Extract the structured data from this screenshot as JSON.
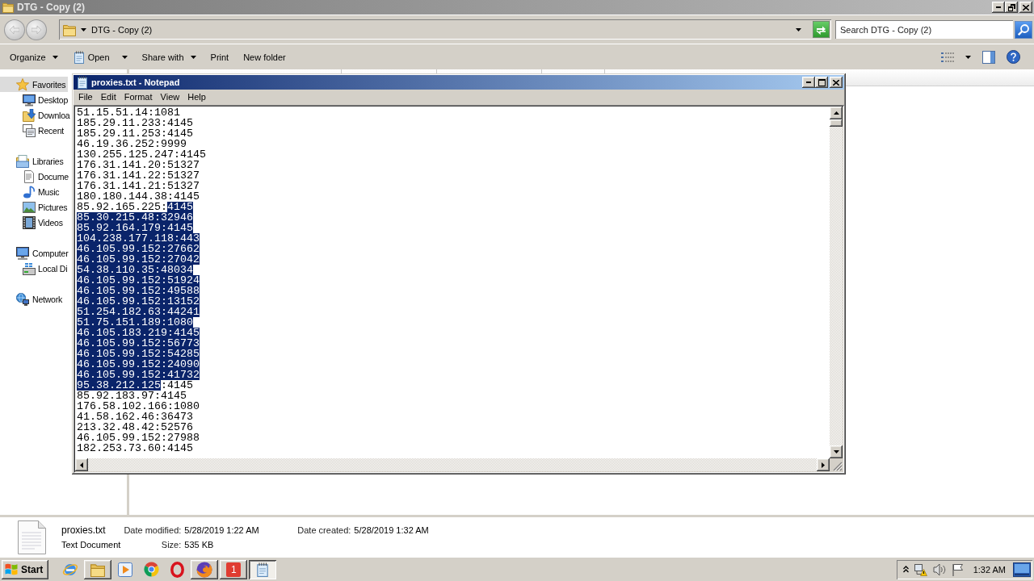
{
  "explorer": {
    "title": "DTG - Copy (2)",
    "address": {
      "path": "DTG - Copy (2)"
    },
    "search": {
      "placeholder": "Search DTG - Copy (2)"
    },
    "toolbar": [
      {
        "label": "Organize",
        "kind": "menu"
      },
      {
        "label": "Open",
        "kind": "split"
      },
      {
        "label": "Share with",
        "kind": "menu"
      },
      {
        "label": "Print",
        "kind": "plain"
      },
      {
        "label": "New folder",
        "kind": "plain"
      }
    ],
    "sidebar": [
      {
        "label": "Favorites",
        "kind": "star",
        "selected": true,
        "children": [
          {
            "label": "Desktop",
            "kind": "desktop",
            "selected": false
          },
          {
            "label": "Downloa",
            "kind": "downloads",
            "selected": false
          },
          {
            "label": "Recent",
            "kind": "recent",
            "selected": false
          }
        ]
      },
      {
        "label": "Libraries",
        "kind": "library",
        "selected": false,
        "children": [
          {
            "label": "Docume",
            "kind": "document",
            "selected": false
          },
          {
            "label": "Music",
            "kind": "music",
            "selected": false
          },
          {
            "label": "Pictures",
            "kind": "pictures",
            "selected": false
          },
          {
            "label": "Videos",
            "kind": "videos",
            "selected": false
          }
        ]
      },
      {
        "label": "Computer",
        "kind": "computer",
        "selected": false,
        "children": [
          {
            "label": "Local Di",
            "kind": "disk",
            "selected": false
          }
        ]
      },
      {
        "label": "Network",
        "kind": "network",
        "selected": false
      }
    ],
    "details": {
      "name": "proxies.txt",
      "type": "Text Document",
      "fields": [
        {
          "label": "Date modified:",
          "value": "5/28/2019 1:22 AM"
        },
        {
          "label": "Date created:",
          "value": "5/28/2019 1:32 AM"
        },
        {
          "label": "Size:",
          "value": "535 KB"
        }
      ]
    }
  },
  "notepad": {
    "title": "proxies.txt - Notepad",
    "menu": [
      "File",
      "Edit",
      "Format",
      "View",
      "Help"
    ],
    "lines": [
      {
        "segments": [
          {
            "text": "51.15.51.14:1081",
            "selected": false
          }
        ]
      },
      {
        "segments": [
          {
            "text": "185.29.11.233:4145",
            "selected": false
          }
        ]
      },
      {
        "segments": [
          {
            "text": "185.29.11.253:4145",
            "selected": false
          }
        ]
      },
      {
        "segments": [
          {
            "text": "46.19.36.252:9999",
            "selected": false
          }
        ]
      },
      {
        "segments": [
          {
            "text": "130.255.125.247:4145",
            "selected": false
          }
        ]
      },
      {
        "segments": [
          {
            "text": "176.31.141.20:51327",
            "selected": false
          }
        ]
      },
      {
        "segments": [
          {
            "text": "176.31.141.22:51327",
            "selected": false
          }
        ]
      },
      {
        "segments": [
          {
            "text": "176.31.141.21:51327",
            "selected": false
          }
        ]
      },
      {
        "segments": [
          {
            "text": "180.180.144.38:4145",
            "selected": false
          }
        ]
      },
      {
        "segments": [
          {
            "text": "85.92.165.225:",
            "selected": false
          },
          {
            "text": "4145",
            "selected": true
          }
        ]
      },
      {
        "segments": [
          {
            "text": "85.30.215.48:32946",
            "selected": true
          }
        ]
      },
      {
        "segments": [
          {
            "text": "85.92.164.179:4145",
            "selected": true
          }
        ]
      },
      {
        "segments": [
          {
            "text": "104.238.177.118:443",
            "selected": true
          }
        ]
      },
      {
        "segments": [
          {
            "text": "46.105.99.152:27662",
            "selected": true
          }
        ]
      },
      {
        "segments": [
          {
            "text": "46.105.99.152:27042",
            "selected": true
          }
        ]
      },
      {
        "segments": [
          {
            "text": "54.38.110.35:48034",
            "selected": true
          }
        ]
      },
      {
        "segments": [
          {
            "text": "46.105.99.152:51924",
            "selected": true
          }
        ]
      },
      {
        "segments": [
          {
            "text": "46.105.99.152:49588",
            "selected": true
          }
        ]
      },
      {
        "segments": [
          {
            "text": "46.105.99.152:13152",
            "selected": true
          }
        ]
      },
      {
        "segments": [
          {
            "text": "51.254.182.63:44241",
            "selected": true
          }
        ]
      },
      {
        "segments": [
          {
            "text": "51.75.151.189:1080",
            "selected": true
          }
        ]
      },
      {
        "segments": [
          {
            "text": "46.105.183.219:4145",
            "selected": true
          }
        ]
      },
      {
        "segments": [
          {
            "text": "46.105.99.152:56773",
            "selected": true
          }
        ]
      },
      {
        "segments": [
          {
            "text": "46.105.99.152:54285",
            "selected": true
          }
        ]
      },
      {
        "segments": [
          {
            "text": "46.105.99.152:24090",
            "selected": true
          }
        ]
      },
      {
        "segments": [
          {
            "text": "46.105.99.152:41732",
            "selected": true
          }
        ]
      },
      {
        "segments": [
          {
            "text": "95.38.212.125",
            "selected": true
          },
          {
            "text": ":4145",
            "selected": false
          }
        ]
      },
      {
        "segments": [
          {
            "text": "85.92.183.97:4145",
            "selected": false
          }
        ]
      },
      {
        "segments": [
          {
            "text": "176.58.102.166:1080",
            "selected": false
          }
        ]
      },
      {
        "segments": [
          {
            "text": "41.58.162.46:36473",
            "selected": false
          }
        ]
      },
      {
        "segments": [
          {
            "text": "213.32.48.42:52576",
            "selected": false
          }
        ]
      },
      {
        "segments": [
          {
            "text": "46.105.99.152:27988",
            "selected": false
          }
        ]
      },
      {
        "segments": [
          {
            "text": "182.253.73.60:4145",
            "selected": false
          }
        ]
      }
    ]
  },
  "taskbar": {
    "start": "Start",
    "items": [
      {
        "kind": "globe",
        "running": false,
        "selected": false
      },
      {
        "kind": "folder",
        "running": true,
        "selected": false
      },
      {
        "kind": "player",
        "running": false,
        "selected": false
      },
      {
        "kind": "wheel",
        "running": false,
        "selected": false
      },
      {
        "kind": "ring",
        "running": false,
        "selected": false
      },
      {
        "kind": "fox",
        "running": true,
        "selected": false
      },
      {
        "kind": "tile",
        "label": "1",
        "running": true,
        "selected": false
      },
      {
        "kind": "notepad",
        "running": true,
        "selected": true
      }
    ],
    "clock": "1:32 AM"
  }
}
